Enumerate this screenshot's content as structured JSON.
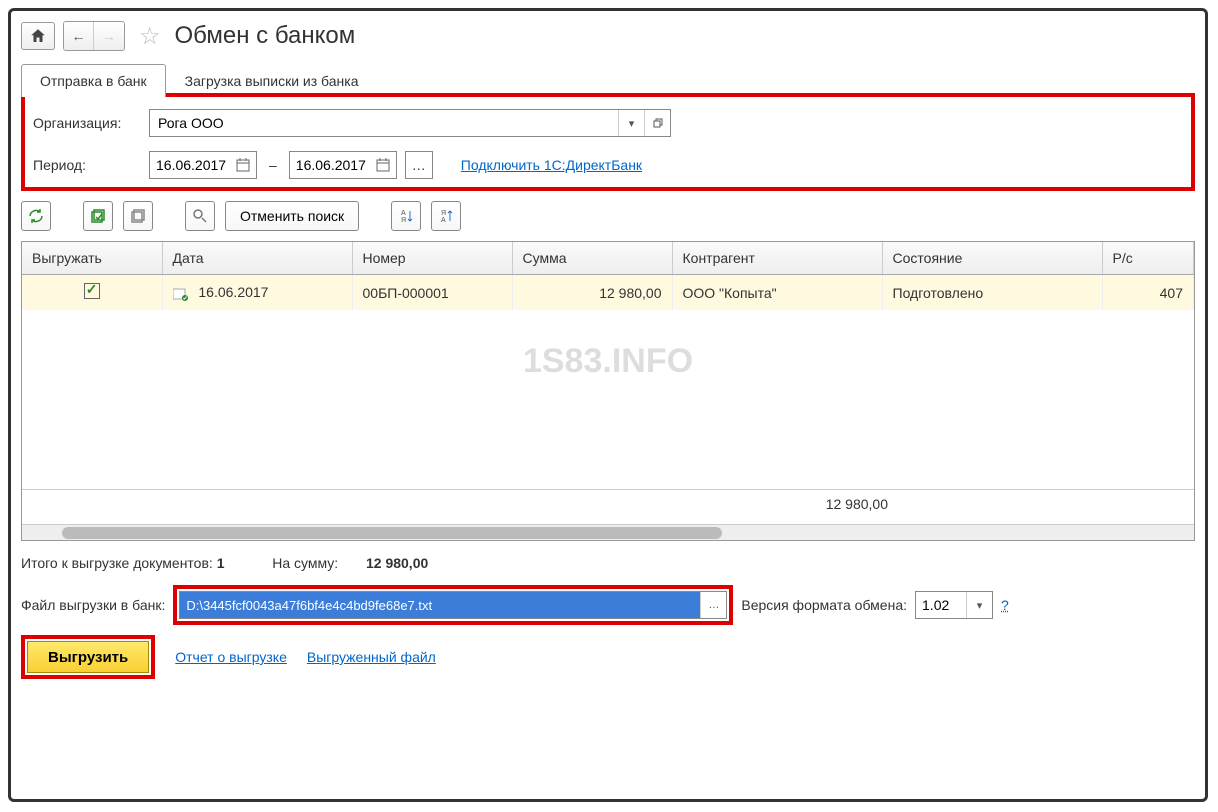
{
  "header": {
    "title": "Обмен с банком"
  },
  "tabs": [
    {
      "label": "Отправка в банк",
      "active": true
    },
    {
      "label": "Загрузка выписки из банка",
      "active": false
    }
  ],
  "form": {
    "org_label": "Организация:",
    "org_value": "Рога ООО",
    "period_label": "Период:",
    "date_from": "16.06.2017",
    "date_to": "16.06.2017",
    "connect_link": "Подключить 1С:ДиректБанк"
  },
  "toolbar": {
    "cancel_search": "Отменить поиск"
  },
  "table": {
    "headers": [
      "Выгружать",
      "Дата",
      "Номер",
      "Сумма",
      "Контрагент",
      "Состояние",
      "Р/с"
    ],
    "row": {
      "checked": true,
      "date": "16.06.2017",
      "number": "00БП-000001",
      "sum": "12 980,00",
      "counterparty": "ООО \"Копыта\"",
      "state": "Подготовлено",
      "account": "407"
    },
    "footer_sum": "12 980,00"
  },
  "watermark": "1S83.INFO",
  "summary": {
    "docs_label": "Итого к выгрузке документов:",
    "docs_count": "1",
    "sum_label": "На сумму:",
    "sum_value": "12 980,00"
  },
  "file": {
    "label": "Файл выгрузки в банк:",
    "value": "D:\\3445fcf0043a47f6bf4e4c4bd9fe68e7.txt",
    "version_label": "Версия формата обмена:",
    "version_value": "1.02",
    "help": "?"
  },
  "actions": {
    "export": "Выгрузить",
    "report_link": "Отчет о выгрузке",
    "file_link": "Выгруженный файл"
  }
}
